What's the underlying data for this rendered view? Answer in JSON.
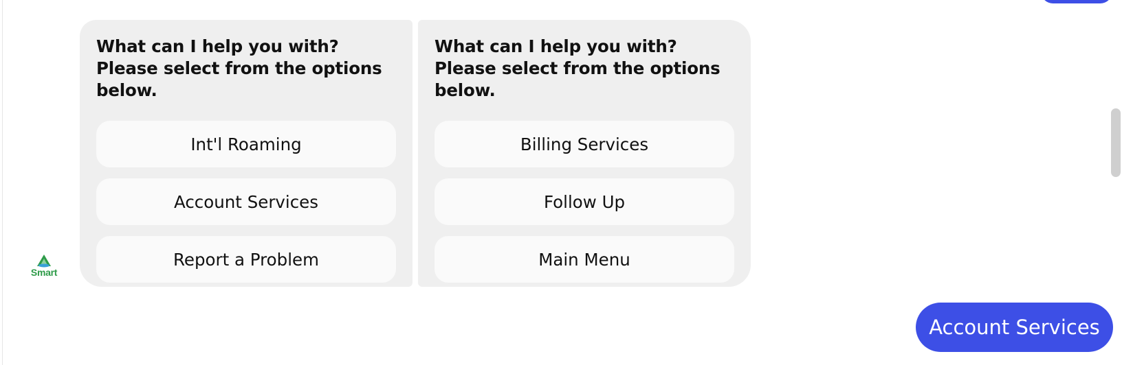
{
  "bot": {
    "avatar_label": "Smart",
    "brand_color": "#2e9b49"
  },
  "cards": [
    {
      "prompt": "What can I help you with? Please select from the options below.",
      "options": [
        "Int'l Roaming",
        "Account Services",
        "Report a Problem"
      ]
    },
    {
      "prompt": "What can I help you with? Please select from the options below.",
      "options": [
        "Billing Services",
        "Follow Up",
        "Main Menu"
      ]
    }
  ],
  "user_message": {
    "text": "Account Services",
    "bubble_color": "#3d4fe6"
  },
  "colors": {
    "card_bg": "#efefef",
    "option_bg": "#fafafa",
    "text": "#111111"
  }
}
